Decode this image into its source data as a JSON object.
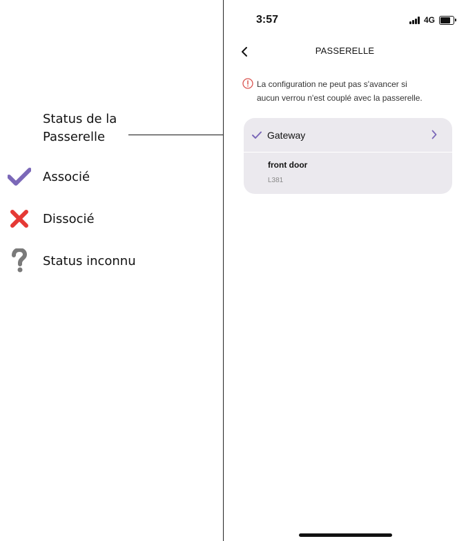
{
  "legend": {
    "callout_line1": "Status de la",
    "callout_line2": "Passerelle",
    "items": [
      {
        "icon": "check-icon",
        "label": "Associé",
        "color": "#7b68b8"
      },
      {
        "icon": "x-icon",
        "label": "Dissocié",
        "color": "#e53935"
      },
      {
        "icon": "question-icon",
        "label": "Status inconnu",
        "color": "#7a7a7a"
      }
    ]
  },
  "phone": {
    "status_bar": {
      "time": "3:57",
      "network": "4G"
    },
    "nav": {
      "title": "PASSERELLE",
      "back_icon": "chevron-left-icon"
    },
    "warning": {
      "icon": "alert-circle-icon",
      "color": "#d9534f",
      "text_line1": "La configuration ne peut pas s'avancer si",
      "text_line2": "aucun verrou n'est couplé avec la passerelle."
    },
    "gateway_card": {
      "gateway": {
        "status_icon": "check-icon",
        "label": "Gateway",
        "chevron_icon": "chevron-right-icon"
      },
      "lock": {
        "name": "front door",
        "model": "L381"
      },
      "accent_color": "#7b68b8",
      "background": "#ebe9ee"
    }
  }
}
